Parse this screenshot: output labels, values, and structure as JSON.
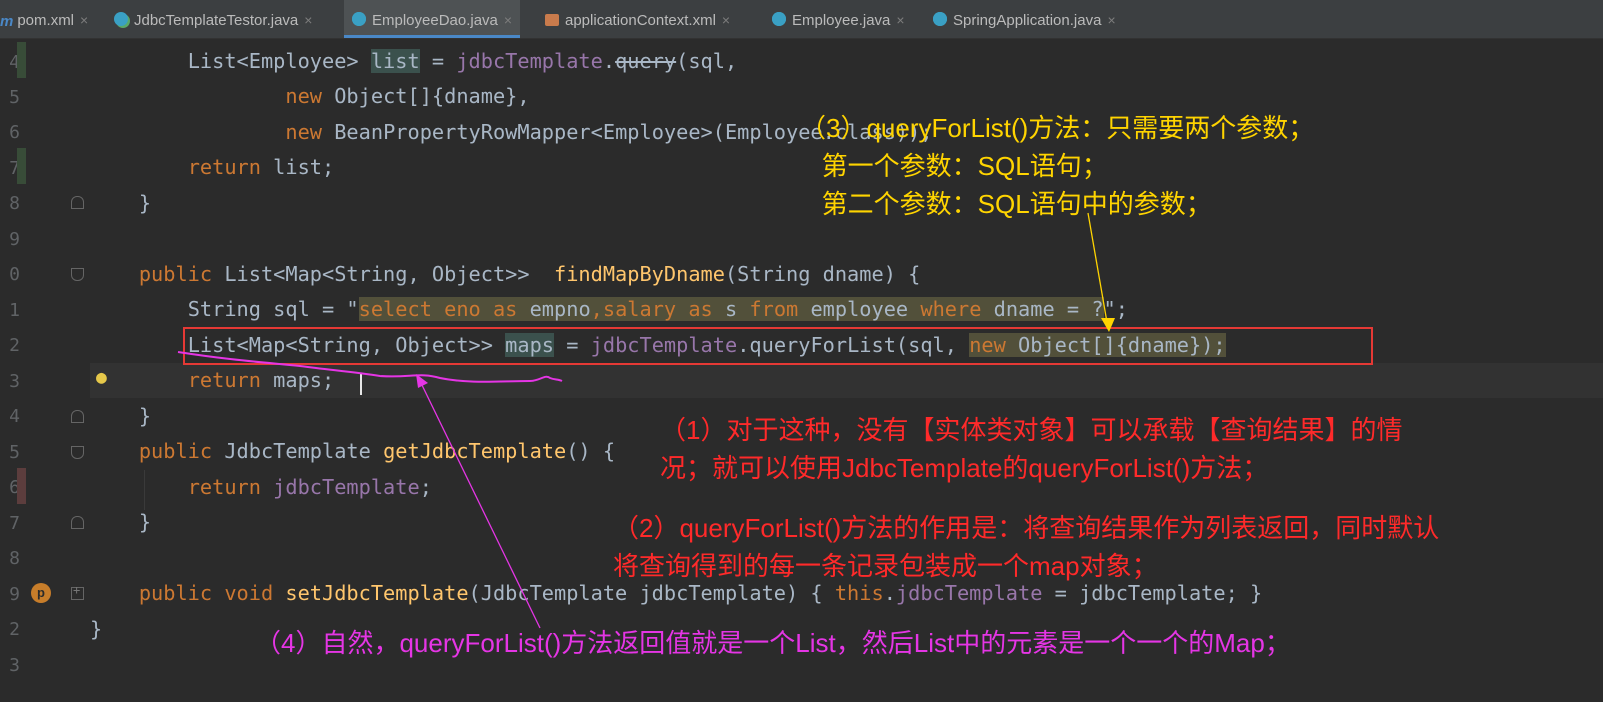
{
  "tabs": [
    {
      "label": "pom.xml",
      "icon": "maven-file-icon"
    },
    {
      "label": "JdbcTemplateTestor.java",
      "icon": "java-test-class-icon"
    },
    {
      "label": "EmployeeDao.java",
      "icon": "java-class-icon",
      "active": true
    },
    {
      "label": "applicationContext.xml",
      "icon": "xml-file-icon"
    },
    {
      "label": "Employee.java",
      "icon": "java-class-icon"
    },
    {
      "label": "SpringApplication.java",
      "icon": "java-class-icon"
    }
  ],
  "tab_close_glyph": "×",
  "line_numbers": [
    "4",
    "5",
    "6",
    "7",
    "8",
    "9",
    "0",
    "1",
    "2",
    "3",
    "4",
    "5",
    "6",
    "7",
    "8",
    "9",
    "2",
    "3"
  ],
  "code": {
    "l1": {
      "indent": "        ",
      "type": "List<Employee> ",
      "var": "list",
      "eq": " = ",
      "field": "jdbcTemplate",
      "dot": ".",
      "method": "query",
      "rest": "(sql,"
    },
    "l2": {
      "indent": "                ",
      "kw": "new",
      "rest": " Object[]{dname},"
    },
    "l3": {
      "indent": "                ",
      "kw": "new",
      "rest": " BeanPropertyRowMapper<Employee>(Employee.class));"
    },
    "l4": {
      "indent": "        ",
      "kw": "return",
      "rest": " list;"
    },
    "l5": {
      "text": "    }"
    },
    "l6": {
      "indent": "    ",
      "kw": "public",
      "type": " List<Map<String, Object>>  ",
      "fn": "findMapByDname",
      "rest": "(String dname) {"
    },
    "l7": {
      "indent": "        ",
      "pre": "String sql = \"",
      "s1": "select eno ",
      "k1": "as",
      "s2": " empno",
      "s3": ",salary ",
      "k2": "as",
      "s4": " s ",
      "k3": "from",
      "s5": " employee ",
      "k4": "where",
      "s6": " dname = ?",
      "post": "\";"
    },
    "l8": {
      "indent": "        ",
      "pre": "List<Map<String, Object>> ",
      "var": "maps",
      "eq": " = ",
      "field": "jdbcTemplate",
      "call": ".queryForList(sql, ",
      "kw": "new",
      "rest": " Object[]{dname});"
    },
    "l9": {
      "indent": "        ",
      "kw": "return",
      "rest": " maps;"
    },
    "l10": {
      "text": "    }"
    },
    "l11": {
      "indent": "    ",
      "kw": "public",
      "type": " JdbcTemplate ",
      "fn": "getJdbcTemplate",
      "rest": "() {"
    },
    "l12": {
      "indent": "        ",
      "kw": "return",
      "field": " jdbcTemplate",
      "rest": ";"
    },
    "l13": {
      "text": "    }"
    },
    "l14": {
      "indent": "    ",
      "kw": "public",
      "kw2": " void ",
      "fn": "setJdbcTemplate",
      "rest": "(JdbcTemplate jdbcTemplate) { ",
      "this": "this",
      "dot": ".",
      "field": "jdbcTemplate",
      "rest2": " = jdbcTemplate; }"
    },
    "l15": {
      "text": "}"
    }
  },
  "annotations": {
    "note3": "（3）queryForList()方法：只需要两个参数；\n   第一个参数：SQL语句；\n   第二个参数：SQL语句中的参数；",
    "note1": "（1）对于这种，没有【实体类对象】可以承载【查询结果】的情\n况；就可以使用JdbcTemplate的queryForList()方法；",
    "note2": "（2）queryForList()方法的作用是：将查询结果作为列表返回，同时默认\n将查询得到的每一条记录包装成一个map对象；",
    "note4": "（4）自然，queryForList()方法返回值就是一个List，然后List中的元素是一个一个的Map；"
  },
  "colors": {
    "editor_bg": "#2b2b2b",
    "keyword": "#cc7832",
    "method": "#ffc66d",
    "field": "#9876aa",
    "string": "#6a8759",
    "annotation_yellow": "#ffd400",
    "annotation_red": "#ff2a2a",
    "annotation_magenta": "#e535e5"
  }
}
